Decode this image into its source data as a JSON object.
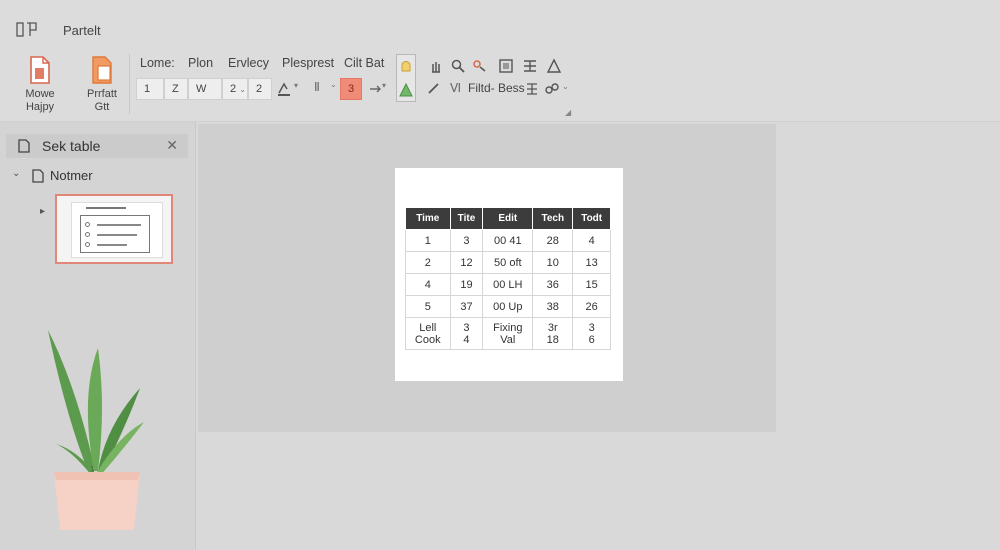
{
  "window": {
    "title": "Partelt"
  },
  "ribbon": {
    "buttons": [
      {
        "label_line1": "Mowe",
        "label_line2": "Hajpy"
      },
      {
        "label_line1": "Prrfatt",
        "label_line2": "Gtt"
      }
    ],
    "menu": [
      "Lome:",
      "Plon",
      "Ervlecy",
      "Plesprest",
      "Cilt Bat"
    ],
    "font_controls": {
      "field1": "1",
      "field2": "Z",
      "field3": "W",
      "size_value": "2",
      "field5": "2",
      "highlight_value": "3"
    },
    "find_label": "Filtd- Bess"
  },
  "panel": {
    "header_title": "Sek table",
    "tree_label": "Notmer"
  },
  "slide": {
    "table": {
      "headers": [
        "Time",
        "Tite",
        "Edit",
        "Tech",
        "Todt"
      ],
      "rows": [
        [
          "1",
          "3",
          "00 41",
          "28",
          "4"
        ],
        [
          "2",
          "12",
          "50 oft",
          "10",
          "13"
        ],
        [
          "4",
          "19",
          "00 LH",
          "36",
          "15"
        ],
        [
          "5",
          "37",
          "00 Up",
          "38",
          "26"
        ]
      ],
      "last_row": {
        "c1_l1": "Lell",
        "c1_l2": "Cook",
        "c2_l1": "3",
        "c2_l2": "4",
        "c3_l1": "Fixing",
        "c3_l2": "Val",
        "c4_l1": "3r",
        "c4_l2": "18",
        "c5_l1": "3",
        "c5_l2": "6"
      }
    }
  },
  "colors": {
    "accent": "#e2867a",
    "header_fill": "#3c3c3c",
    "highlight": "#f08b78"
  }
}
